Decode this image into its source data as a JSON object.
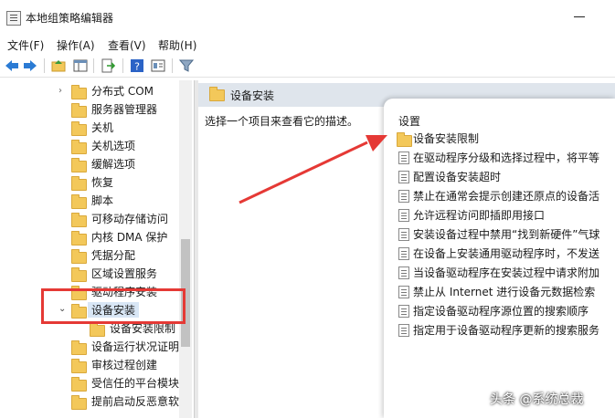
{
  "window": {
    "title": "本地组策略编辑器"
  },
  "menu": [
    "文件(F)",
    "操作(A)",
    "查看(V)",
    "帮助(H)"
  ],
  "toolbar": [
    "back-icon",
    "forward-icon",
    "up-folder-icon",
    "show-tree-icon",
    "export-icon",
    "help-icon",
    "properties-icon",
    "filter-icon"
  ],
  "tree": {
    "items": [
      "分布式 COM",
      "服务器管理器",
      "关机",
      "关机选项",
      "缓解选项",
      "恢复",
      "脚本",
      "可移动存储访问",
      "内核 DMA 保护",
      "凭据分配",
      "区域设置服务",
      "驱动程序安装",
      "设备安装",
      "设备安装限制",
      "设备运行状况证明",
      "审核过程创建",
      "受信任的平台模块",
      "提前启动反恶意软"
    ],
    "selected": "设备安装"
  },
  "right": {
    "header": "设备安装",
    "description": "选择一个项目来查看它的描述。",
    "setting_header": "设置",
    "settings": [
      "设备安装限制",
      "在驱动程序分级和选择过程中，将平等",
      "配置设备安装超时",
      "禁止在通常会提示创建还原点的设备活",
      "允许远程访问即插即用接口",
      "安装设备过程中禁用“找到新硬件”气球",
      "在设备上安装通用驱动程序时，不发送",
      "当设备驱动程序在安装过程中请求附加",
      "禁止从 Internet 进行设备元数据检索",
      "指定设备驱动程序源位置的搜索顺序",
      "指定用于设备驱动程序更新的搜索服务"
    ]
  },
  "watermark": "头条 @系统总裁",
  "colors": {
    "highlight": "#e53935",
    "arrow": "#e53935",
    "folder": "#f3c85a",
    "header": "#dfe5ec"
  }
}
